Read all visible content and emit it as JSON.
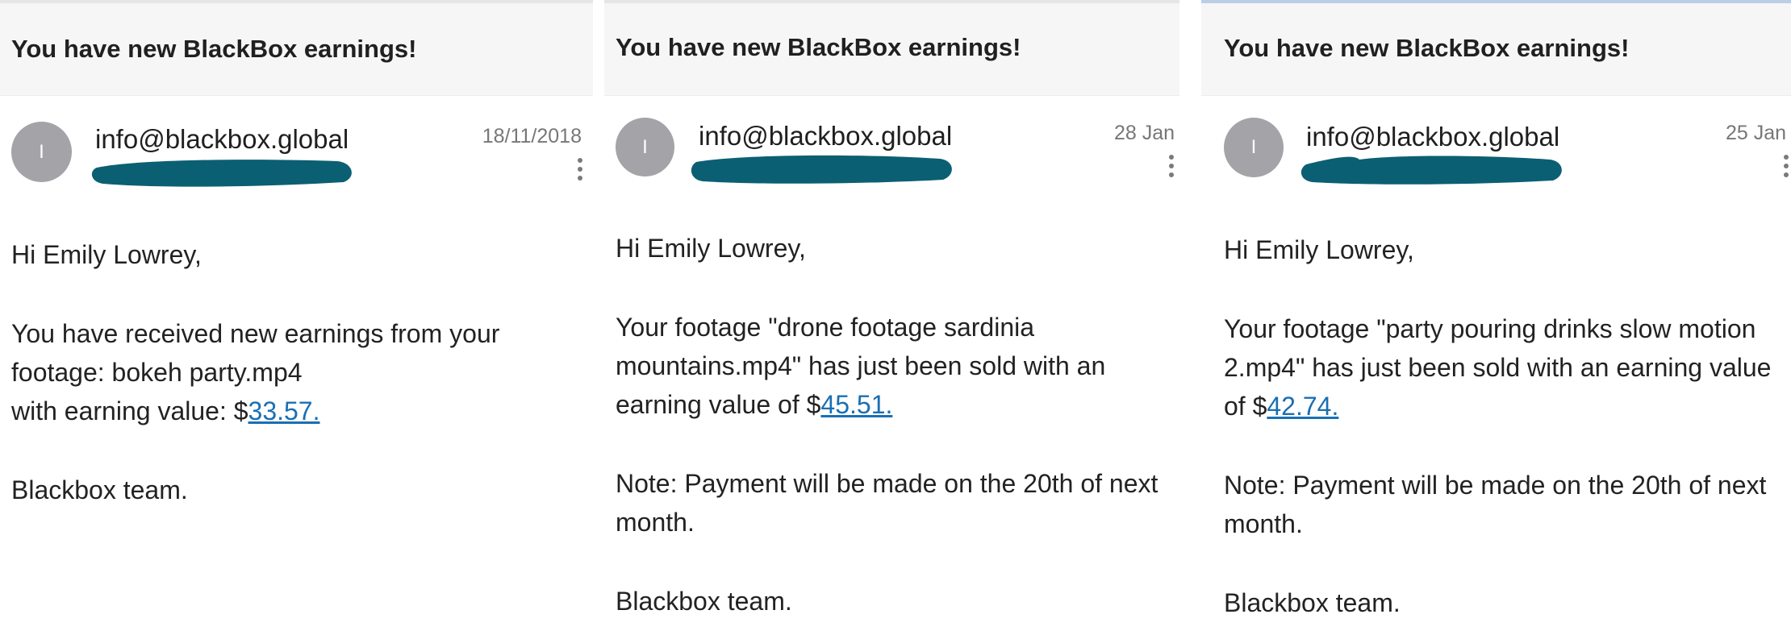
{
  "emails": [
    {
      "subject": "You have new BlackBox earnings!",
      "avatar_letter": "I",
      "sender": "info@blackbox.global",
      "date": "18/11/2018",
      "greeting": "Hi Emily Lowrey,",
      "line1": "You have received new earnings from your",
      "line2": "footage: bokeh party.mp4",
      "line3_prefix": "with earning value: $",
      "amount": "33.57.",
      "signoff": "Blackbox team.",
      "icons": {
        "menu": "more-vertical-icon"
      }
    },
    {
      "subject": "You have new BlackBox earnings!",
      "avatar_letter": "I",
      "sender": "info@blackbox.global",
      "date": "28 Jan",
      "greeting": "Hi Emily Lowrey,",
      "message_prefix": "Your footage \"drone footage sardinia mountains.mp4\" has just been sold with an earning value of $",
      "amount": "45.51.",
      "note": "Note: Payment will be made on the 20th of next month.",
      "signoff": "Blackbox team.",
      "icons": {
        "menu": "more-vertical-icon"
      }
    },
    {
      "subject": "You have new BlackBox earnings!",
      "avatar_letter": "I",
      "sender": "info@blackbox.global",
      "date": "25 Jan",
      "greeting": "Hi Emily Lowrey,",
      "message_prefix": "Your footage \"party pouring drinks slow motion 2.mp4\" has just been sold with an earning value of $",
      "amount": "42.74.",
      "note": "Note: Payment will be made on the 20th of next month.",
      "signoff": "Blackbox team.",
      "icons": {
        "menu": "more-vertical-icon"
      }
    }
  ],
  "colors": {
    "redaction": "#0b5f73",
    "link": "#1a6fb3",
    "avatar": "#a3a3a8",
    "subject_bar": "#f6f6f6"
  }
}
